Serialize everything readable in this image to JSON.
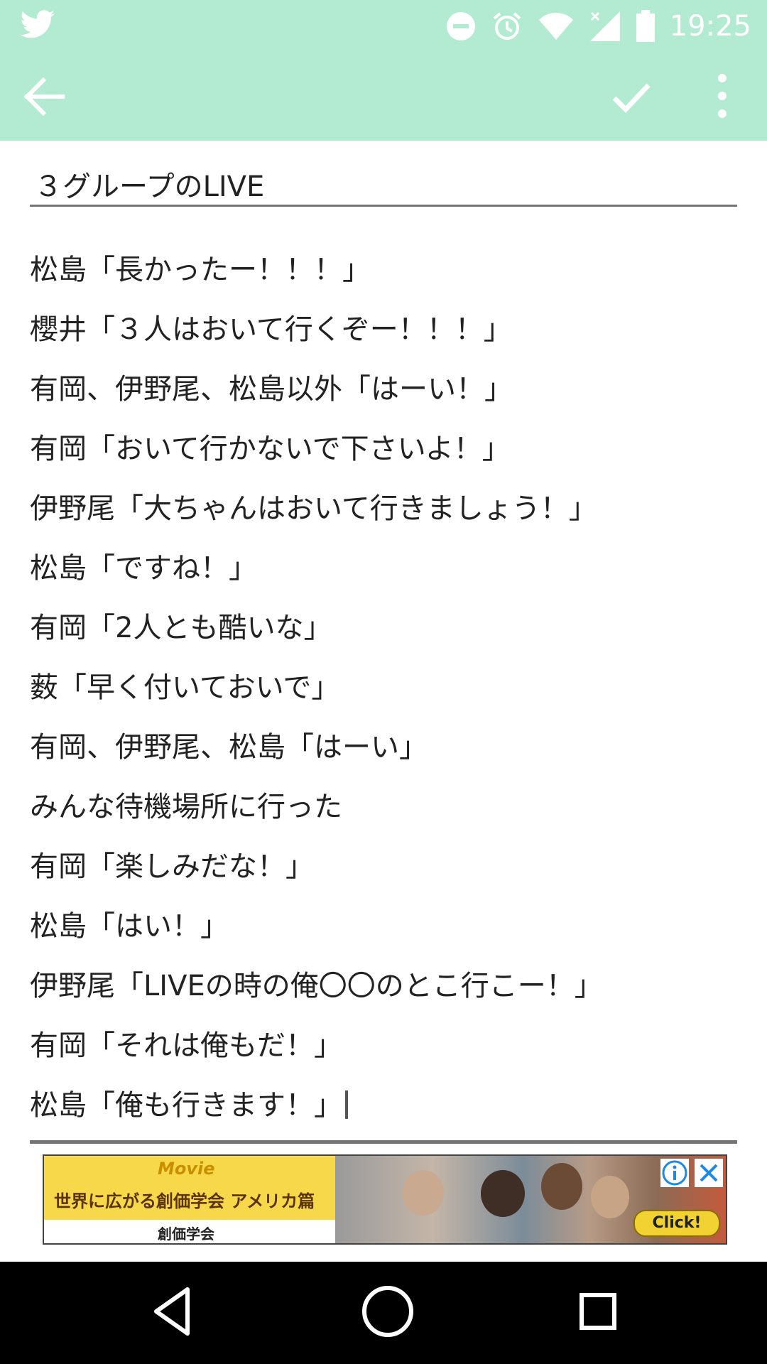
{
  "status_bar": {
    "time": "19:25",
    "icons": [
      "twitter-icon",
      "dnd-icon",
      "alarm-icon",
      "wifi-icon",
      "signal-icon",
      "battery-icon"
    ]
  },
  "toolbar": {
    "icons": [
      "back-arrow-icon",
      "check-icon",
      "more-vert-icon"
    ]
  },
  "editor": {
    "title": "３グループのLIVE",
    "lines": [
      "松島「長かったー！！！」",
      "櫻井「３人はおいて行くぞー！！！」",
      "有岡、伊野尾、松島以外「はーい！」",
      "有岡「おいて行かないで下さいよ！」",
      "伊野尾「大ちゃんはおいて行きましょう！」",
      "松島「ですね！」",
      "有岡「2人とも酷いな」",
      "薮「早く付いておいで」",
      "有岡、伊野尾、松島「はーい」",
      "みんな待機場所に行った",
      "有岡「楽しみだな！」",
      "松島「はい！」",
      "伊野尾「LIVEの時の俺〇〇のとこ行こー！」",
      "有岡「それは俺もだ！」",
      "松島「俺も行きます！」"
    ]
  },
  "ad": {
    "movie_label": "Movie",
    "headline": "世界に広がる創価学会 アメリカ篇",
    "sponsor": "創価学会",
    "cta": "Click!",
    "colors": {
      "banner": "#f7d84a",
      "info": "#1e88e5"
    }
  },
  "nav_bar": {
    "icons": [
      "nav-back-icon",
      "nav-home-icon",
      "nav-recents-icon"
    ]
  },
  "colors": {
    "appbar": "#b3ead2",
    "text": "#222222",
    "underline": "#757575"
  }
}
